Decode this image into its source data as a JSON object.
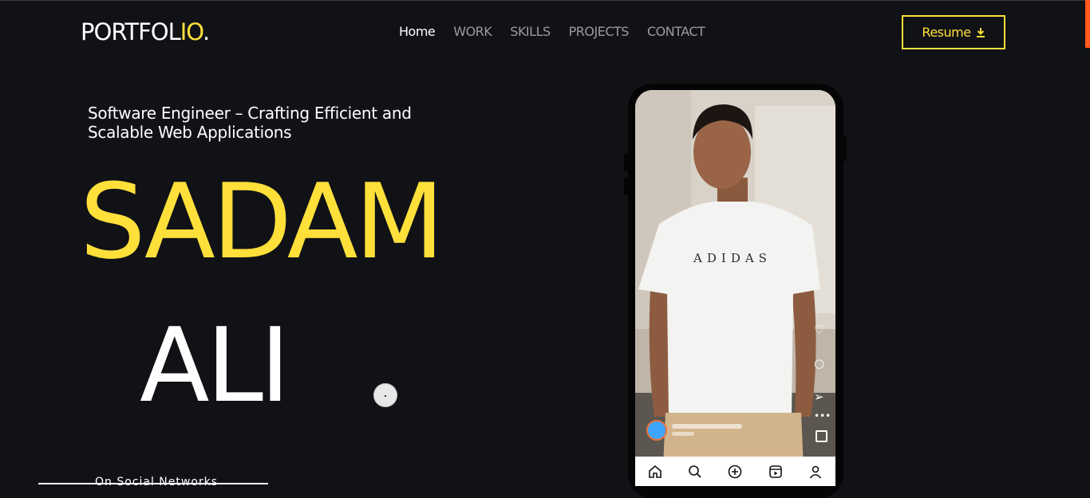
{
  "brand": {
    "logo_main": "PORTFOL",
    "logo_accent": "IO",
    "logo_dot": "."
  },
  "nav": {
    "items": [
      {
        "label": "Home",
        "active": true
      },
      {
        "label": "WORK",
        "active": false
      },
      {
        "label": "SKILLS",
        "active": false
      },
      {
        "label": "PROJECTS",
        "active": false
      },
      {
        "label": "CONTACT",
        "active": false
      }
    ]
  },
  "resume": {
    "label": "Resume",
    "icon": "download-icon"
  },
  "hero": {
    "tagline": "Software Engineer – Crafting Efficient and Scalable Web Applications",
    "first_name": "SADAM",
    "last_name": "ALI",
    "social_label": "On Social Networks"
  },
  "phone": {
    "shirt_text": "ADIDAS",
    "side_icons": [
      "heart-icon",
      "comment-icon",
      "send-icon",
      "more-icon"
    ],
    "bottom_nav": [
      "home-icon",
      "search-icon",
      "add-icon",
      "reels-icon",
      "profile-icon"
    ]
  },
  "colors": {
    "accent": "#ffe03a",
    "background": "#111216",
    "muted_nav": "#9a9aa0"
  }
}
